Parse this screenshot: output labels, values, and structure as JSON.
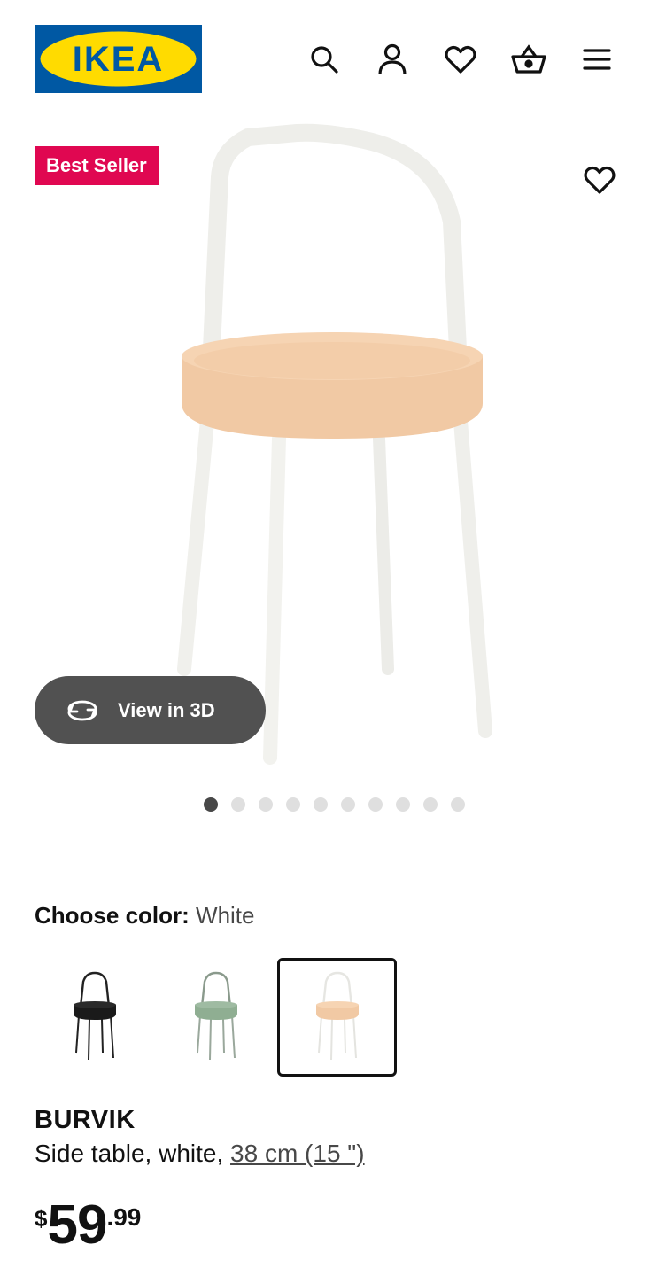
{
  "header": {
    "brand": "IKEA",
    "icons": [
      "search-icon",
      "account-icon",
      "heart-icon",
      "basket-icon",
      "menu-icon"
    ]
  },
  "hero": {
    "badge": "Best Seller",
    "view3d_label": "View in 3D",
    "carousel": {
      "total": 10,
      "active": 1
    }
  },
  "color_chooser": {
    "label": "Choose color:",
    "selected": "White",
    "options": [
      "Black",
      "Green",
      "White"
    ]
  },
  "product": {
    "name": "BURVIK",
    "description": "Side table, white,",
    "size_link": "38 cm (15 \")",
    "price": {
      "currency": "$",
      "integer": "59",
      "decimal": ".99"
    }
  },
  "colors": {
    "ikea_blue": "#0058a3",
    "ikea_yellow": "#ffdb00",
    "badge_red": "#e00751",
    "button_dark": "#484848"
  }
}
